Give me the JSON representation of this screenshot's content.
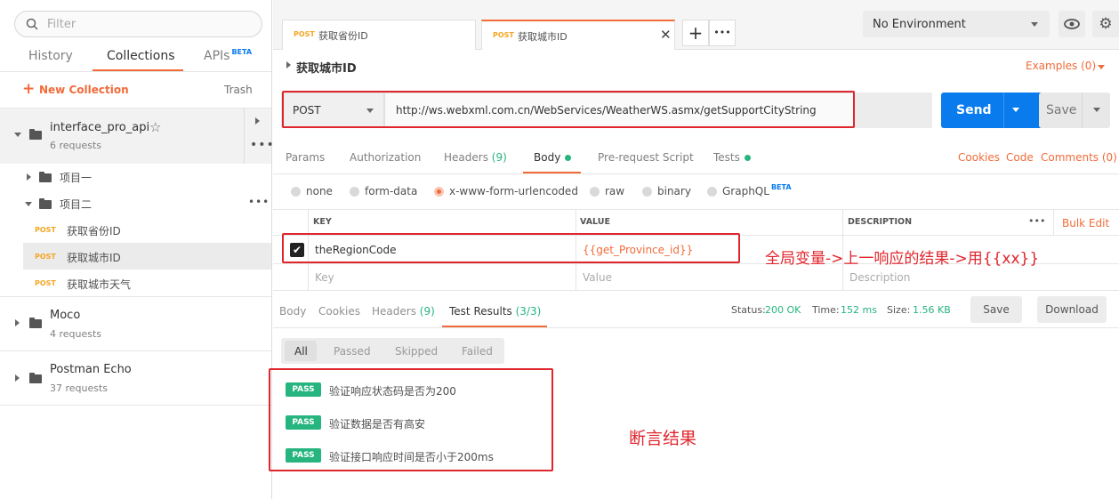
{
  "sidebar": {
    "filter_placeholder": "Filter",
    "tabs": [
      "History",
      "Collections",
      "APIs"
    ],
    "apis_badge": "BETA",
    "new_collection": "New Collection",
    "trash": "Trash",
    "collections": [
      {
        "name": "interface_pro_api",
        "sub": "6 requests"
      },
      {
        "name": "Moco",
        "sub": "4 requests"
      },
      {
        "name": "Postman Echo",
        "sub": "37 requests"
      }
    ],
    "folders": [
      "项目一",
      "项目二"
    ],
    "requests": [
      {
        "method": "POST",
        "name": "获取省份ID"
      },
      {
        "method": "POST",
        "name": "获取城市ID"
      },
      {
        "method": "POST",
        "name": "获取城市天气"
      }
    ]
  },
  "tabs": [
    {
      "method": "POST",
      "name": "获取省份ID"
    },
    {
      "method": "POST",
      "name": "获取城市ID"
    }
  ],
  "environment": "No Environment",
  "request": {
    "title": "获取城市ID",
    "examples": "Examples (0)",
    "method": "POST",
    "url": "http://ws.webxml.com.cn/WebServices/WeatherWS.asmx/getSupportCityString",
    "send": "Send",
    "save": "Save"
  },
  "req_tabs": {
    "params": "Params",
    "authorization": "Authorization",
    "headers": "Headers",
    "headers_count": "(9)",
    "body": "Body",
    "prerequest": "Pre-request Script",
    "tests": "Tests",
    "cookies": "Cookies",
    "code": "Code",
    "comments": "Comments (0)"
  },
  "body_types": [
    "none",
    "form-data",
    "x-www-form-urlencoded",
    "raw",
    "binary",
    "GraphQL"
  ],
  "graphql_badge": "BETA",
  "table": {
    "headers": [
      "KEY",
      "VALUE",
      "DESCRIPTION"
    ],
    "bulk_edit": "Bulk Edit",
    "row": {
      "key": "theRegionCode",
      "value": "{{get_Province_id}}"
    },
    "placeholder": {
      "key": "Key",
      "value": "Value",
      "description": "Description"
    }
  },
  "annotation_global": "全局变量->上一响应的结果->用{{xx}}",
  "response": {
    "tabs": [
      "Body",
      "Cookies",
      "Headers",
      "Test Results"
    ],
    "headers_count": "(9)",
    "test_count": "(3/3)",
    "status_label": "Status:",
    "status": "200 OK",
    "time_label": "Time:",
    "time": "152 ms",
    "size_label": "Size:",
    "size": "1.56 KB",
    "save": "Save",
    "download": "Download",
    "filters": [
      "All",
      "Passed",
      "Skipped",
      "Failed"
    ],
    "tests": [
      {
        "status": "PASS",
        "name": "验证响应状态码是否为200"
      },
      {
        "status": "PASS",
        "name": "验证数据是否有高安"
      },
      {
        "status": "PASS",
        "name": "验证接口响应时间是否小于200ms"
      }
    ]
  },
  "annotation_assert": "断言结果",
  "colors": {
    "accent": "#f26b3a",
    "send": "#097bed",
    "pass": "#26b47f",
    "annotation": "#e0262d"
  }
}
